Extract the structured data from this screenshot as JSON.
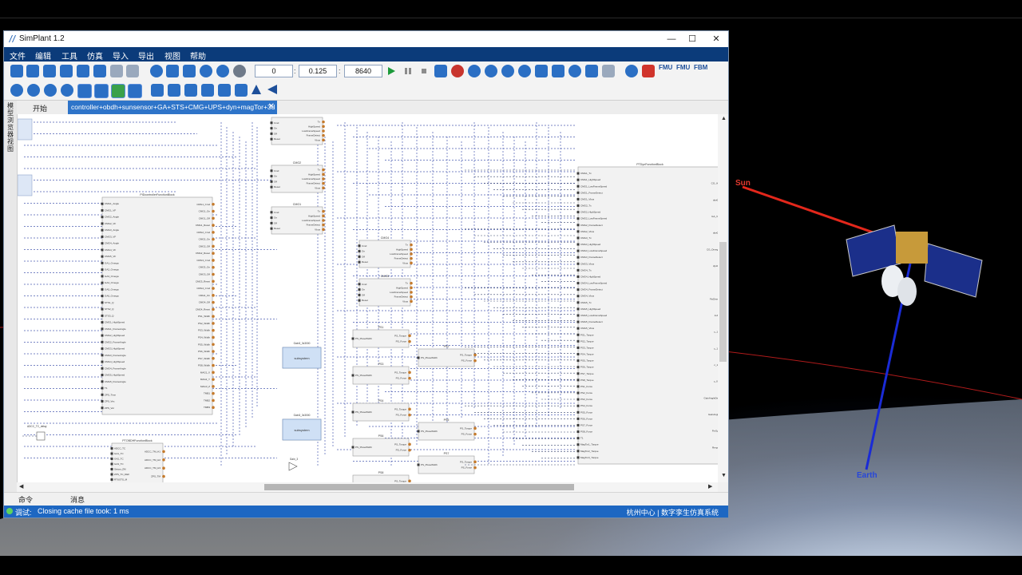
{
  "app": {
    "title": "SimPlant 1.2"
  },
  "window_controls": {
    "minimize": "—",
    "maximize": "☐",
    "close": "✕"
  },
  "menu": [
    "文件",
    "编辑",
    "工具",
    "仿真",
    "导入",
    "导出",
    "视图",
    "帮助"
  ],
  "toolbar": {
    "start_time": "0",
    "step": "0.125",
    "end_time": "8640",
    "sep": ":",
    "fmu1": "FMU",
    "fmu2": "FMU",
    "fbm": "FBM"
  },
  "side_panel": {
    "label": "模型浏览器视图"
  },
  "tabs": {
    "start": "开始",
    "active": "controller+obdh+sunsensor+GA+STS+CMG+UPS+dyn+magTor+3d",
    "close": "✕"
  },
  "bottom_tabs": [
    "命令",
    "消息"
  ],
  "status": {
    "level": "调试:",
    "message": "Closing cache file took: 1 ms",
    "right": "杭州中心 | 数字孪生仿真系统"
  },
  "scene": {
    "sun_label": "Sun",
    "earth_label": "Earth"
  },
  "diagram": {
    "cmg_blocks": [
      "CMG2",
      "CMG1",
      "CMG4",
      "CMG5"
    ],
    "cmg_ports_in": [
      "Cmd",
      "On",
      "Off",
      "Reset"
    ],
    "cmg_ports_out": [
      "Tx",
      "HighSpeed",
      "LowFrameSpeed",
      "FrameDetect",
      "Vbus"
    ],
    "ctrl_block": "PIDcontrollerFunctionBlock",
    "obdh_block": "PTOBDHFunctionBlock",
    "dyn_block": "PTDynFunctionBlock",
    "ps_blocks": [
      "PS1",
      "PS2",
      "PS3",
      "PS4",
      "PS5",
      "PS6",
      "PS7",
      "PS8"
    ],
    "subsystem_label": "subsystem",
    "gain_labels": [
      "Gain3_3x3000",
      "Gain3_3x3000",
      "Gain_3"
    ],
    "delay_label": "ADCC_TC_delay"
  }
}
